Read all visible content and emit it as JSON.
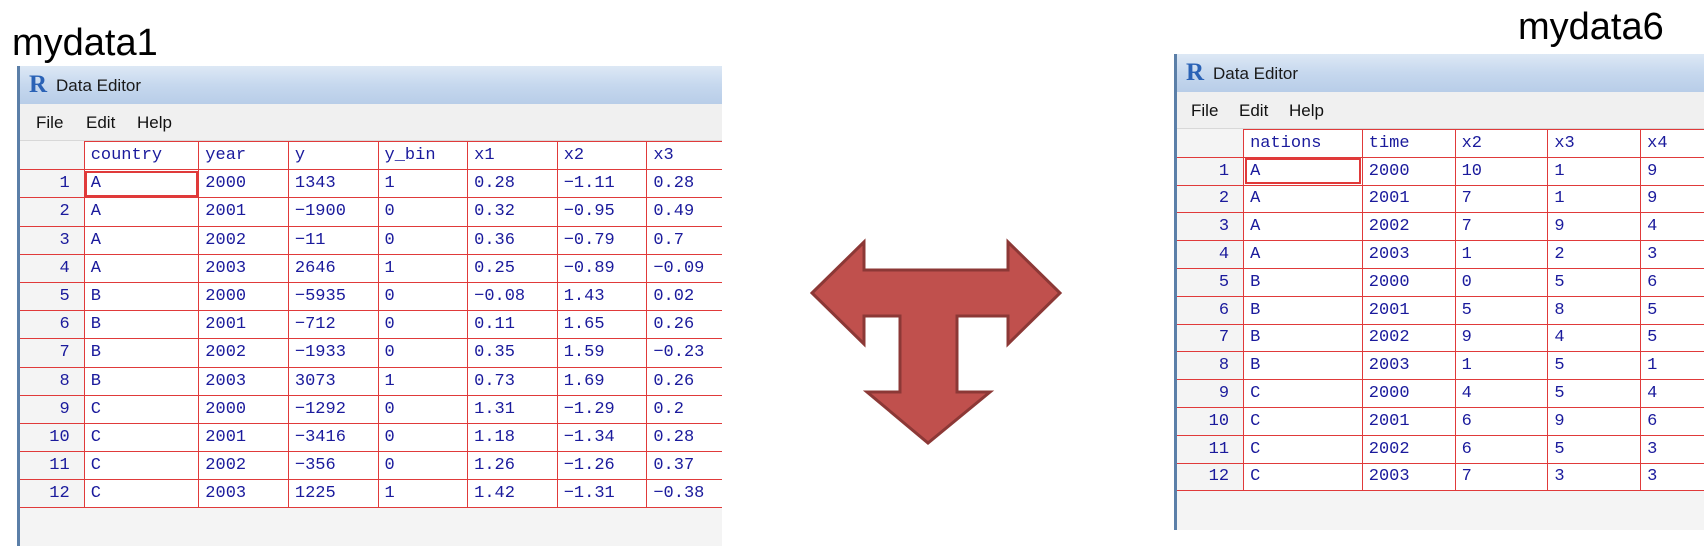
{
  "left": {
    "caption": "mydata1",
    "window_title": "Data Editor",
    "menus": [
      "File",
      "Edit",
      "Help"
    ],
    "columns": [
      "country",
      "year",
      "y",
      "y_bin",
      "x1",
      "x2",
      "x3"
    ],
    "rows": [
      {
        "n": "1",
        "cells": [
          "A",
          "2000",
          "1343",
          "1",
          "0.28",
          "−1.11",
          "0.28"
        ]
      },
      {
        "n": "2",
        "cells": [
          "A",
          "2001",
          "−1900",
          "0",
          "0.32",
          "−0.95",
          "0.49"
        ]
      },
      {
        "n": "3",
        "cells": [
          "A",
          "2002",
          "−11",
          "0",
          "0.36",
          "−0.79",
          "0.7"
        ]
      },
      {
        "n": "4",
        "cells": [
          "A",
          "2003",
          "2646",
          "1",
          "0.25",
          "−0.89",
          "−0.09"
        ]
      },
      {
        "n": "5",
        "cells": [
          "B",
          "2000",
          "−5935",
          "0",
          "−0.08",
          "1.43",
          "0.02"
        ]
      },
      {
        "n": "6",
        "cells": [
          "B",
          "2001",
          "−712",
          "0",
          "0.11",
          "1.65",
          "0.26"
        ]
      },
      {
        "n": "7",
        "cells": [
          "B",
          "2002",
          "−1933",
          "0",
          "0.35",
          "1.59",
          "−0.23"
        ]
      },
      {
        "n": "8",
        "cells": [
          "B",
          "2003",
          "3073",
          "1",
          "0.73",
          "1.69",
          "0.26"
        ]
      },
      {
        "n": "9",
        "cells": [
          "C",
          "2000",
          "−1292",
          "0",
          "1.31",
          "−1.29",
          "0.2"
        ]
      },
      {
        "n": "10",
        "cells": [
          "C",
          "2001",
          "−3416",
          "0",
          "1.18",
          "−1.34",
          "0.28"
        ]
      },
      {
        "n": "11",
        "cells": [
          "C",
          "2002",
          "−356",
          "0",
          "1.26",
          "−1.26",
          "0.37"
        ]
      },
      {
        "n": "12",
        "cells": [
          "C",
          "2003",
          "1225",
          "1",
          "1.42",
          "−1.31",
          "−0.38"
        ]
      }
    ]
  },
  "right": {
    "caption": "mydata6",
    "window_title": "Data Editor",
    "menus": [
      "File",
      "Edit",
      "Help"
    ],
    "columns": [
      "nations",
      "time",
      "x2",
      "x3",
      "x4"
    ],
    "rows": [
      {
        "n": "1",
        "cells": [
          "A",
          "2000",
          "10",
          "1",
          "9"
        ]
      },
      {
        "n": "2",
        "cells": [
          "A",
          "2001",
          "7",
          "1",
          "9"
        ]
      },
      {
        "n": "3",
        "cells": [
          "A",
          "2002",
          "7",
          "9",
          "4"
        ]
      },
      {
        "n": "4",
        "cells": [
          "A",
          "2003",
          "1",
          "2",
          "3"
        ]
      },
      {
        "n": "5",
        "cells": [
          "B",
          "2000",
          "0",
          "5",
          "6"
        ]
      },
      {
        "n": "6",
        "cells": [
          "B",
          "2001",
          "5",
          "8",
          "5"
        ]
      },
      {
        "n": "7",
        "cells": [
          "B",
          "2002",
          "9",
          "4",
          "5"
        ]
      },
      {
        "n": "8",
        "cells": [
          "B",
          "2003",
          "1",
          "5",
          "1"
        ]
      },
      {
        "n": "9",
        "cells": [
          "C",
          "2000",
          "4",
          "5",
          "4"
        ]
      },
      {
        "n": "10",
        "cells": [
          "C",
          "2001",
          "6",
          "9",
          "6"
        ]
      },
      {
        "n": "11",
        "cells": [
          "C",
          "2002",
          "6",
          "5",
          "3"
        ]
      },
      {
        "n": "12",
        "cells": [
          "C",
          "2003",
          "7",
          "3",
          "3"
        ]
      }
    ]
  },
  "colors": {
    "grid_line": "#e03a3a",
    "cell_text": "#1a1a9c",
    "arrow_fill": "#c0504d",
    "arrow_stroke": "#8c3836"
  },
  "icons": {
    "app_logo": "r-logo-icon",
    "arrow": "t-shaped-three-way-arrow-icon"
  }
}
